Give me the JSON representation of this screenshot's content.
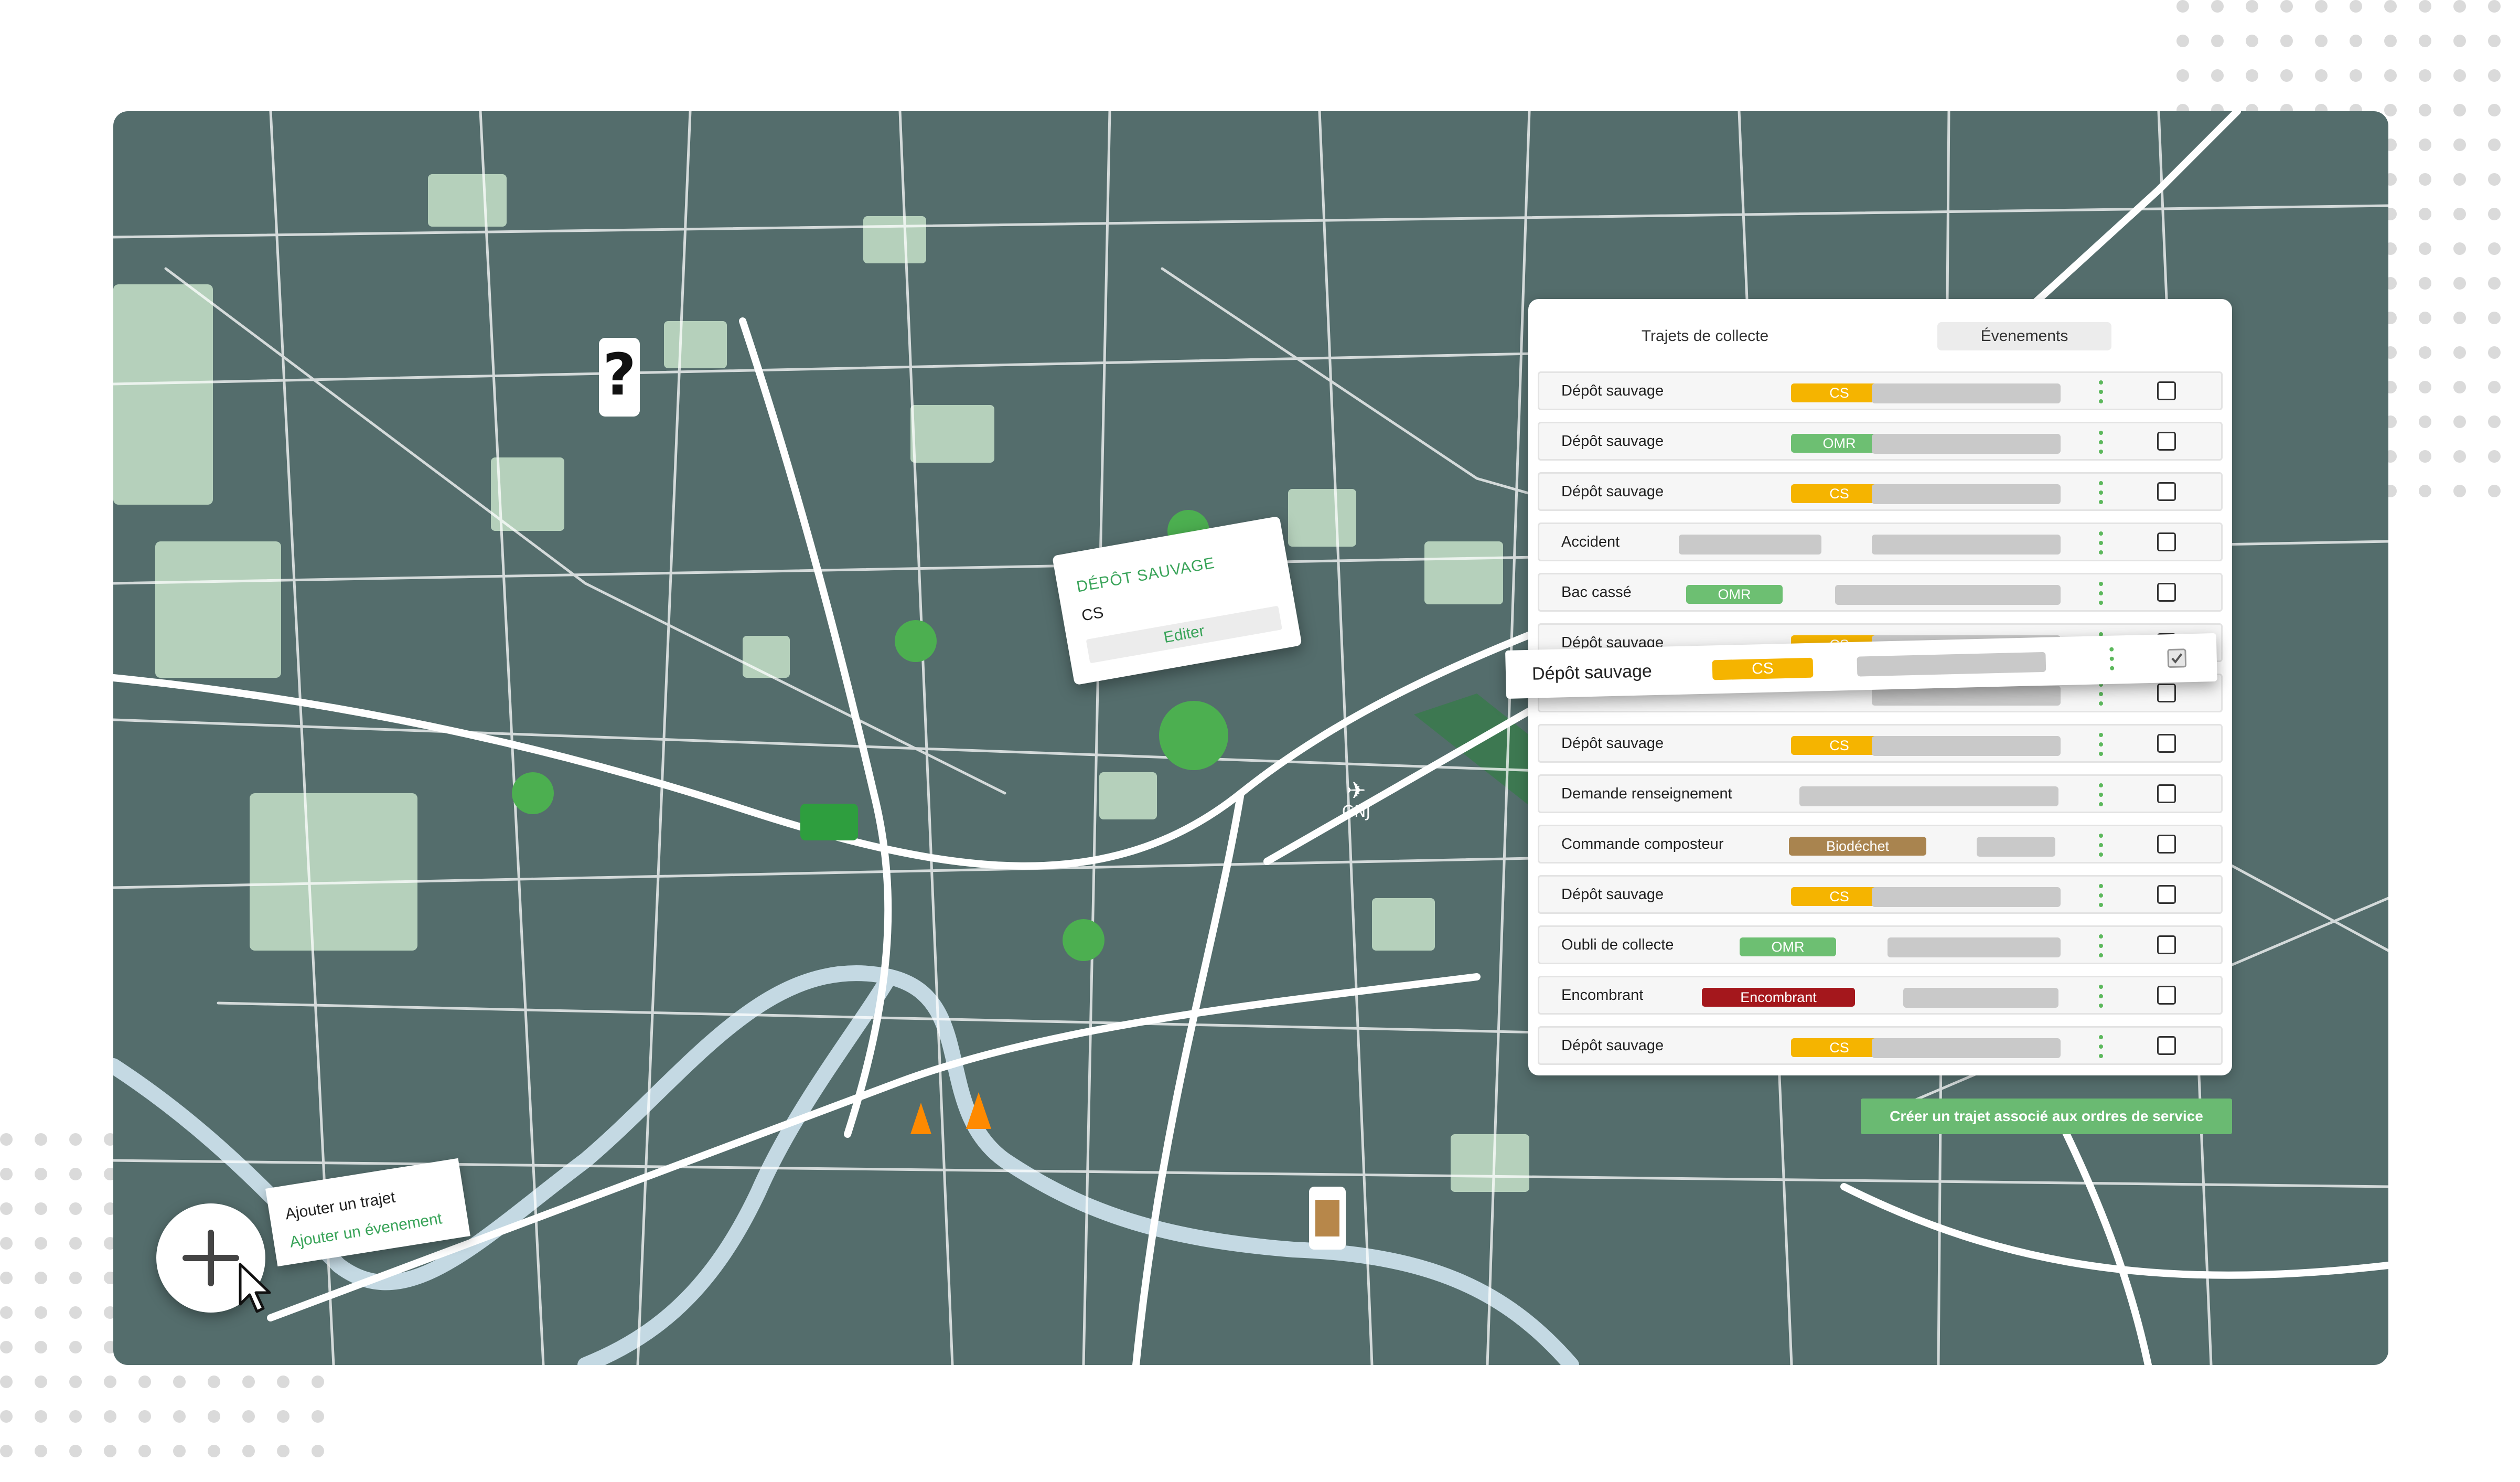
{
  "panel": {
    "tab_routes": "Trajets de collecte",
    "tab_events": "Évenements",
    "rows": [
      {
        "label": "Dépôt sauvage",
        "badge": "CS",
        "badge_color": "#f5b400"
      },
      {
        "label": "Dépôt sauvage",
        "badge": "OMR",
        "badge_color": "#6dbf72"
      },
      {
        "label": "Dépôt sauvage",
        "badge": "CS",
        "badge_color": "#f5b400"
      },
      {
        "label": "Accident",
        "badge": "",
        "badge_color": ""
      },
      {
        "label": "Bac cassé",
        "badge": "OMR",
        "badge_color": "#6dbf72"
      },
      {
        "label": "Dépôt sauvage",
        "badge": "CS",
        "badge_color": "#f5b400"
      },
      {
        "label": "",
        "badge": "",
        "badge_color": ""
      },
      {
        "label": "Dépôt sauvage",
        "badge": "CS",
        "badge_color": "#f5b400"
      },
      {
        "label": "Demande renseignement",
        "badge": "",
        "badge_color": ""
      },
      {
        "label": "Commande composteur",
        "badge": "Biodéchet",
        "badge_color": "#a9844f"
      },
      {
        "label": "Dépôt sauvage",
        "badge": "CS",
        "badge_color": "#f5b400"
      },
      {
        "label": "Oubli de collecte",
        "badge": "OMR",
        "badge_color": "#6dbf72"
      },
      {
        "label": "Encombrant",
        "badge": "Encombrant",
        "badge_color": "#a4171c"
      },
      {
        "label": "Dépôt sauvage",
        "badge": "CS",
        "badge_color": "#f5b400"
      }
    ],
    "dragged_row": {
      "label": "Dépôt sauvage",
      "badge": "CS",
      "badge_color": "#f5b400"
    }
  },
  "create_button": "Créer un trajet associé aux ordres de service",
  "popup": {
    "title": "DÉPÔT SAUVAGE",
    "subtitle": "CS",
    "edit": "Editer"
  },
  "add_menu": {
    "add_route": "Ajouter un trajet",
    "add_event": "Ajouter un évenement"
  },
  "map": {
    "airport_code": "GNJ",
    "colors": {
      "land": "#546d6c",
      "park": "#c7e2c9",
      "road": "#ffffff",
      "river": "#c4d9e3"
    }
  },
  "icons": {
    "fab": "plus-icon",
    "cursor": "mouse-pointer-icon",
    "row_menu": "kebab-menu-icon",
    "airport": "airport-icon"
  }
}
